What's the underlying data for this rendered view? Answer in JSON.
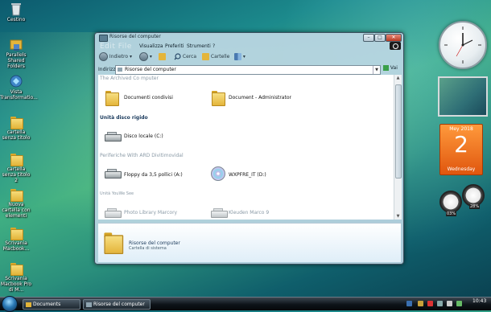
{
  "desktop": {
    "icons": [
      {
        "label": "Cestino"
      },
      {
        "label": "Parallels Shared Folders"
      },
      {
        "label": "Vista Transformatio..."
      },
      {
        "label": "cartella senza titolo"
      },
      {
        "label": "cartella senza titolo 2"
      },
      {
        "label": "Nuova cartella con elementi"
      },
      {
        "label": "Scrivania Macbook..."
      },
      {
        "label": "Scrivania Macbook Pro di M..."
      }
    ]
  },
  "window": {
    "title": "Risorse del computer",
    "watermark": "Edit File",
    "menu": [
      "Visualizza",
      "Preferiti",
      "Strumenti",
      "?"
    ],
    "toolbar": {
      "back": "Indietro",
      "search": "Cerca",
      "folders": "Cartelle"
    },
    "address": {
      "label": "Indirizzo",
      "value": "Risorse del computer",
      "go": "Vai"
    },
    "groups": {
      "stored_files": "The Archived Co  mputer",
      "hard_disks": "Unità disco rigido",
      "removable": "Periferiche With ARD Divitimovidal",
      "network": "Unità YouWe See"
    },
    "items": {
      "shared_docs": "Documenti condivisi",
      "admin_docs": "Document  - Administrator",
      "local_disk": "Disco locale (C:)",
      "floppy": "Floppy da 3,5 pollici (A:)",
      "cd_drive": "WXPFRE_IT (D:)",
      "photo_library": "Photo Library Marcory",
      "kleuden": "Kleuden Marco 9"
    },
    "details": {
      "title": "Risorse del computer",
      "subtitle": "Cartella di sistema"
    }
  },
  "gadgets": {
    "calendar": {
      "month": "Mey 2018",
      "day": "2",
      "weekday": "Wednesday"
    },
    "meter": {
      "cpu": "03%",
      "ram": "28%"
    }
  },
  "taskbar": {
    "buttons": [
      "Documents",
      "Risorse del computer"
    ],
    "time": "10:43"
  }
}
